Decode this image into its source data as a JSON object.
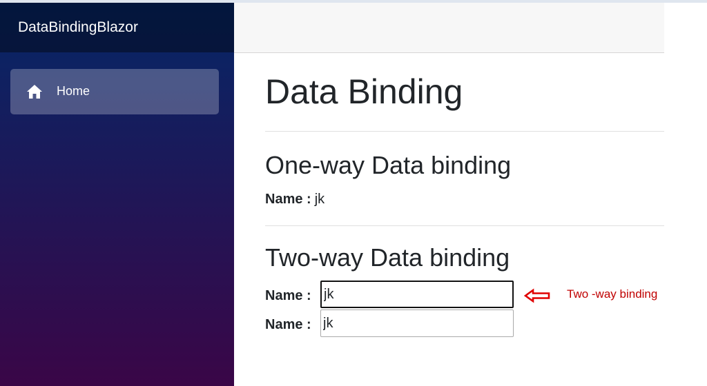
{
  "app": {
    "brand": "DataBindingBlazor"
  },
  "sidebar": {
    "items": [
      {
        "label": "Home",
        "icon": "home-icon",
        "active": true
      }
    ]
  },
  "main": {
    "title": "Data Binding",
    "one_way": {
      "heading": "One-way Data binding",
      "name_label": "Name :",
      "name_value": "jk"
    },
    "two_way": {
      "heading": "Two-way Data binding",
      "name_label": "Name :",
      "input1_value": "jk",
      "input2_value": "jk"
    }
  },
  "annotation": {
    "text": "Two -way binding",
    "icon": "left-arrow-icon",
    "color": "#c00000"
  },
  "colors": {
    "sidebar_top": "#052767",
    "sidebar_bottom": "#3a0647",
    "annotation": "#c00000"
  }
}
